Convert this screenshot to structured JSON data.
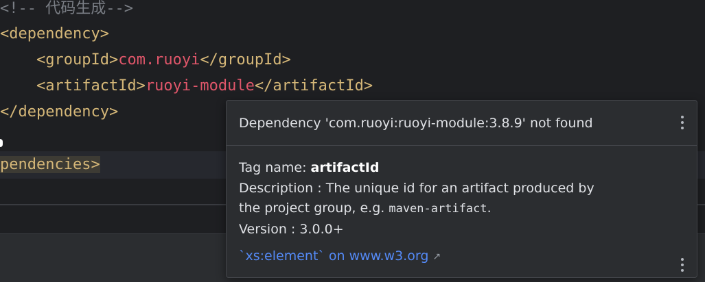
{
  "editor": {
    "lines": {
      "comment": "<!-- 代码生成-->",
      "dep_open": "<dependency>",
      "group_open": "<groupId>",
      "group_value": "com.ruoyi",
      "group_close": "</groupId>",
      "artifact_open": "<artifactId>",
      "artifact_value": "ruoyi-module",
      "artifact_close": "</artifactId>",
      "dep_close": "</dependency>",
      "deps_close_partial": "pendencies>"
    }
  },
  "popup": {
    "title": "Dependency 'com.ruoyi:ruoyi-module:3.8.9' not found",
    "tag_name_label": "Tag name: ",
    "tag_name_value": "artifactId",
    "description_line1": "Description : The unique id for an artifact produced by",
    "description_line2_prefix": "the project group, e.g. ",
    "description_line2_code": "maven-artifact",
    "description_line2_suffix": ".",
    "version": "Version : 3.0.0+",
    "link_text": "`xs:element` on www.w3.org",
    "link_icon": "↗"
  },
  "colors": {
    "background": "#1e1f22",
    "tag": "#d5b778",
    "value_red": "#e0566a",
    "comment": "#7a7e85",
    "link": "#548af7",
    "popup_bg": "#2b2d30"
  }
}
